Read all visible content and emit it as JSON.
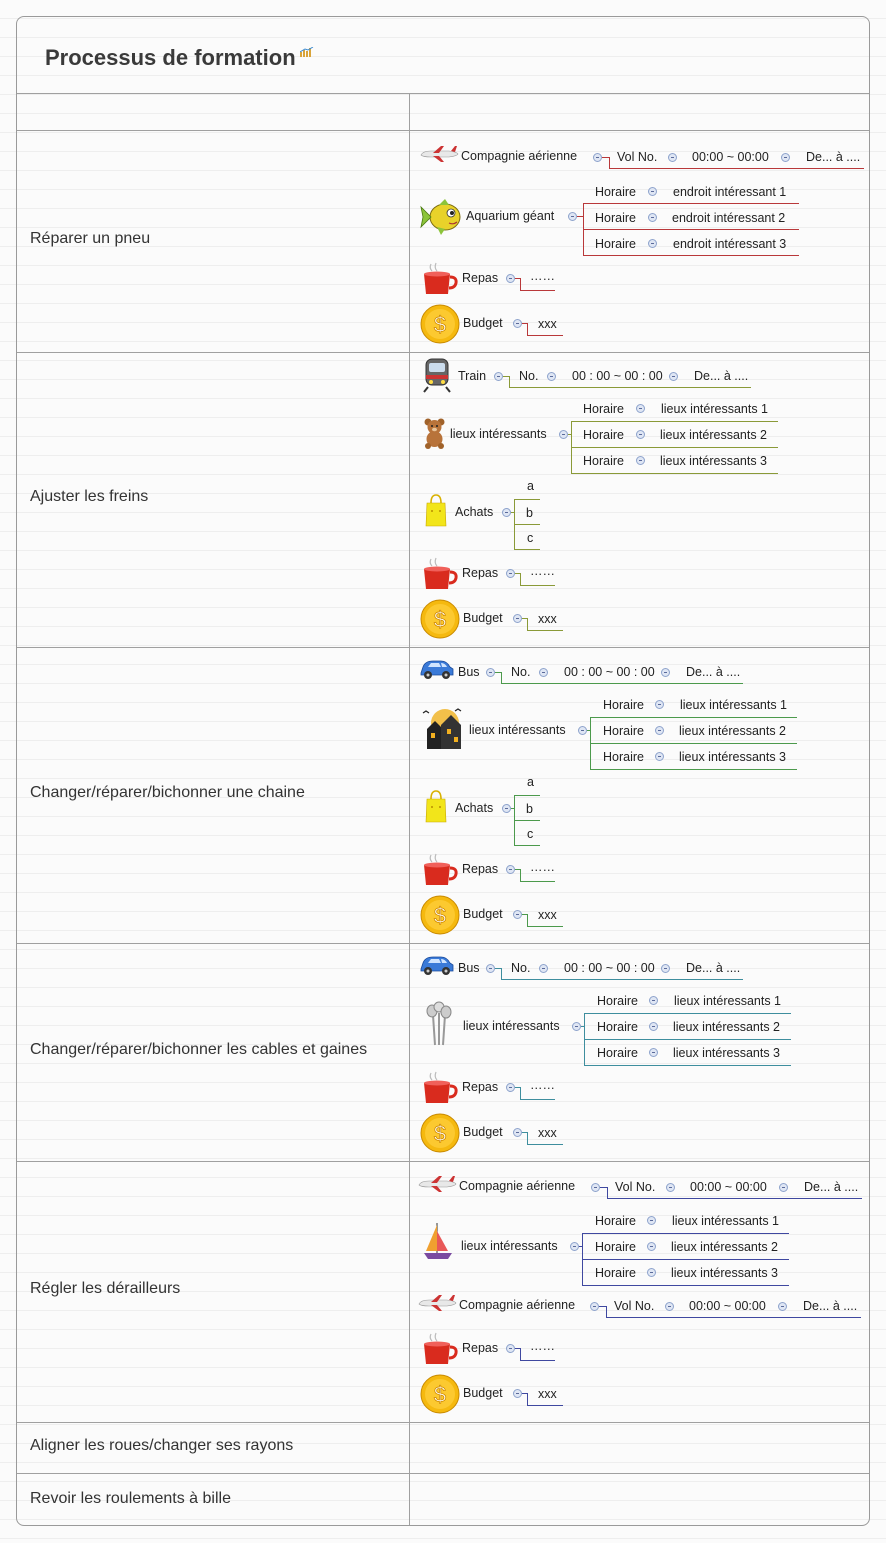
{
  "title": "Processus de formation",
  "colors": {
    "row1": "#b9383a",
    "row2": "#8a9a38",
    "row3": "#4c9a4c",
    "row4": "#3e8e9e",
    "row5": "#3f48a0"
  },
  "rows": [
    {
      "label": "Réparer un pneu",
      "nodes": {
        "transport": "Compagnie aérienne",
        "no": "Vol No.",
        "time": "00:00 ~ 00:00",
        "dest": "De... à ....",
        "place": "Aquarium géant",
        "horaire": [
          "Horaire",
          "Horaire",
          "Horaire"
        ],
        "places": [
          "endroit intéressant 1",
          "endroit intéressant 2",
          "endroit intéressant 3"
        ],
        "repas": "Repas",
        "repas_val": "……",
        "budget": "Budget",
        "budget_val": "xxx"
      }
    },
    {
      "label": "Ajuster les freins",
      "nodes": {
        "transport": "Train",
        "no": "No.",
        "time": "00 : 00 ~ 00 : 00",
        "dest": "De... à ....",
        "place": "lieux intéressants",
        "horaire": [
          "Horaire",
          "Horaire",
          "Horaire"
        ],
        "places": [
          "lieux intéressants 1",
          "lieux intéressants 2",
          "lieux intéressants 3"
        ],
        "achats": "Achats",
        "achats_items": [
          "a",
          "b",
          "c"
        ],
        "repas": "Repas",
        "repas_val": "……",
        "budget": "Budget",
        "budget_val": "xxx"
      }
    },
    {
      "label": "Changer/réparer/bichonner une chaine",
      "nodes": {
        "transport": "Bus",
        "no": "No.",
        "time": "00 : 00 ~ 00 : 00",
        "dest": "De... à ....",
        "place": "lieux intéressants",
        "horaire": [
          "Horaire",
          "Horaire",
          "Horaire"
        ],
        "places": [
          "lieux intéressants 1",
          "lieux intéressants 2",
          "lieux intéressants 3"
        ],
        "achats": "Achats",
        "achats_items": [
          "a",
          "b",
          "c"
        ],
        "repas": "Repas",
        "repas_val": "……",
        "budget": "Budget",
        "budget_val": "xxx"
      }
    },
    {
      "label": "Changer/réparer/bichonner les cables et gaines",
      "nodes": {
        "transport": "Bus",
        "no": "No.",
        "time": "00 : 00 ~ 00 : 00",
        "dest": "De... à ....",
        "place": "lieux intéressants",
        "horaire": [
          "Horaire",
          "Horaire",
          "Horaire"
        ],
        "places": [
          "lieux intéressants 1",
          "lieux intéressants 2",
          "lieux intéressants 3"
        ],
        "repas": "Repas",
        "repas_val": "……",
        "budget": "Budget",
        "budget_val": "xxx"
      }
    },
    {
      "label": "Régler les dérailleurs",
      "nodes": {
        "transport": "Compagnie aérienne",
        "no": "Vol No.",
        "time": "00:00 ~ 00:00",
        "dest": "De... à ....",
        "place": "lieux intéressants",
        "horaire": [
          "Horaire",
          "Horaire",
          "Horaire"
        ],
        "places": [
          "lieux intéressants 1",
          "lieux intéressants 2",
          "lieux intéressants 3"
        ],
        "transport2": "Compagnie aérienne",
        "no2": "Vol No.",
        "time2": "00:00 ~ 00:00",
        "dest2": "De... à ....",
        "repas": "Repas",
        "repas_val": "……",
        "budget": "Budget",
        "budget_val": "xxx"
      }
    },
    {
      "label": "Aligner les roues/changer ses rayons"
    },
    {
      "label": "Revoir les roulements à bille"
    }
  ]
}
